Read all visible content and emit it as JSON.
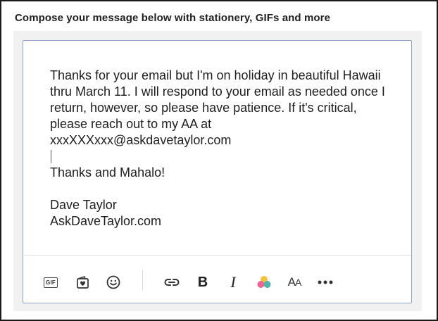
{
  "heading": "Compose your message below with stationery, GIFs and more",
  "message": {
    "paragraph1": "Thanks for your email but I'm on holiday in beautiful Hawaii thru March 11. I will respond to your email as needed once I return, however, so please have patience. If it's critical, please reach out to my AA at xxxXXXxxx@askdavetaylor.com",
    "closing": "Thanks and Mahalo!",
    "signature_name": "Dave Taylor",
    "signature_site": "AskDaveTaylor.com"
  },
  "toolbar": {
    "gif_label": "GIF",
    "bold_label": "B",
    "italic_label": "I",
    "font_size_label": "A",
    "font_size_label_small": "A",
    "items": [
      "gif-icon",
      "stationery-icon",
      "emoji-icon",
      "link-icon",
      "bold-icon",
      "italic-icon",
      "color-icon",
      "font-size-icon",
      "more-icon"
    ]
  },
  "colors": {
    "editor_border": "#8fa3c9",
    "color_dot_yellow": "#f5c33b",
    "color_dot_pink": "#f06292",
    "color_dot_green": "#4db6ac"
  }
}
